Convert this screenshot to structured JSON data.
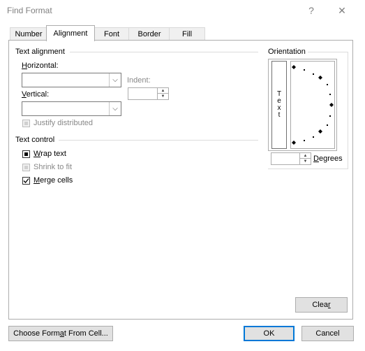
{
  "window": {
    "title": "Find Format",
    "help_glyph": "?",
    "close_glyph": "✕"
  },
  "tabs": [
    {
      "label": "Number"
    },
    {
      "label": "Alignment"
    },
    {
      "label": "Font"
    },
    {
      "label": "Border"
    },
    {
      "label": "Fill"
    }
  ],
  "text_alignment": {
    "section_label": "Text alignment",
    "horizontal_label_u": "H",
    "horizontal_label_rest": "orizontal:",
    "horizontal_value": "",
    "vertical_label_u": "V",
    "vertical_label_rest": "ertical:",
    "vertical_value": "",
    "indent_label": "Indent:",
    "indent_value": "",
    "justify_label": "Justify distributed"
  },
  "text_control": {
    "section_label": "Text control",
    "wrap_u": "W",
    "wrap_rest": "rap text",
    "shrink_label": "Shrink to fit",
    "merge_u": "M",
    "merge_rest": "erge cells",
    "wrap_state": "indeterminate",
    "shrink_state": "disabled",
    "merge_state": "checked"
  },
  "orientation": {
    "section_label": "Orientation",
    "vertical_text": [
      "T",
      "e",
      "x",
      "t"
    ],
    "degrees_value": "",
    "degrees_u": "D",
    "degrees_rest": "egrees"
  },
  "buttons": {
    "clear_pre": "Clea",
    "clear_u": "r",
    "choose_pre": "Choose Form",
    "choose_u": "a",
    "choose_post": "t From Cell...",
    "ok": "OK",
    "cancel": "Cancel"
  },
  "colors": {
    "accent": "#0078d7",
    "border": "#adadad",
    "disabled_text": "#888888"
  }
}
